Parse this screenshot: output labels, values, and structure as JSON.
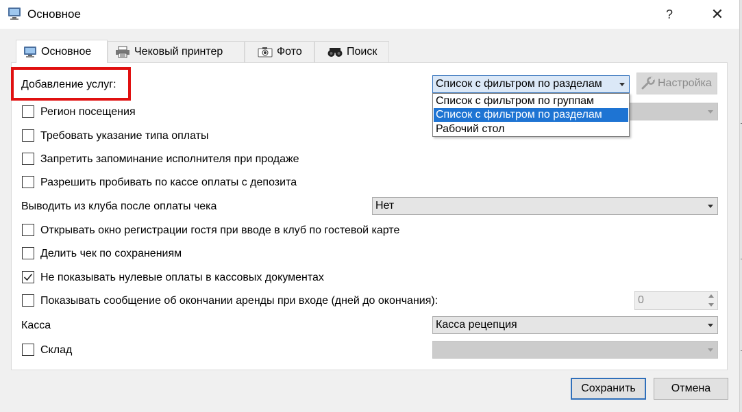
{
  "window": {
    "title": "Основное",
    "help_label": "?",
    "close_label": "✕"
  },
  "tabs": [
    {
      "label": "Основное",
      "icon": "monitor-icon",
      "active": true
    },
    {
      "label": "Чековый принтер",
      "icon": "printer-icon",
      "active": false
    },
    {
      "label": "Фото",
      "icon": "camera-icon",
      "active": false
    },
    {
      "label": "Поиск",
      "icon": "binoculars-icon",
      "active": false
    }
  ],
  "settings": {
    "add_services": {
      "label": "Добавление услуг:",
      "value": "Список с фильтром по разделам",
      "options": [
        "Список с фильтром по группам",
        "Список с фильтром по разделам",
        "Рабочий стол"
      ],
      "selected_index": 1,
      "configure_label": "Настройка"
    },
    "visit_region": {
      "label": "Регион посещения",
      "checked": false
    },
    "require_payment_type": {
      "label": "Требовать указание типа оплаты",
      "checked": false
    },
    "forbid_remember_executor": {
      "label": "Запретить запоминание исполнителя при продаже",
      "checked": false
    },
    "allow_deposit_payments": {
      "label": "Разрешить пробивать по кассе оплаты с депозита",
      "checked": false
    },
    "exit_club": {
      "label": "Выводить из клуба после оплаты чека",
      "value": "Нет"
    },
    "open_guest_registration": {
      "label": "Открывать окно регистрации гостя при вводе в клуб по гостевой карте",
      "checked": false
    },
    "split_receipt": {
      "label": "Делить чек по сохранениям",
      "checked": false
    },
    "hide_zero_payments": {
      "label": "Не показывать нулевые оплаты в кассовых документах",
      "checked": true
    },
    "rent_end_message": {
      "label": "Показывать сообщение об окончании аренды при входе (дней до окончания):",
      "checked": false,
      "value": "0"
    },
    "cashbox": {
      "label": "Касса",
      "value": "Касса рецепция"
    },
    "warehouse": {
      "label": "Склад",
      "checked": false,
      "value": ""
    }
  },
  "buttons": {
    "save": "Сохранить",
    "cancel": "Отмена"
  },
  "colors": {
    "highlight": "#e01010",
    "selection": "#1e74d3",
    "focus": "#2f6fba"
  }
}
